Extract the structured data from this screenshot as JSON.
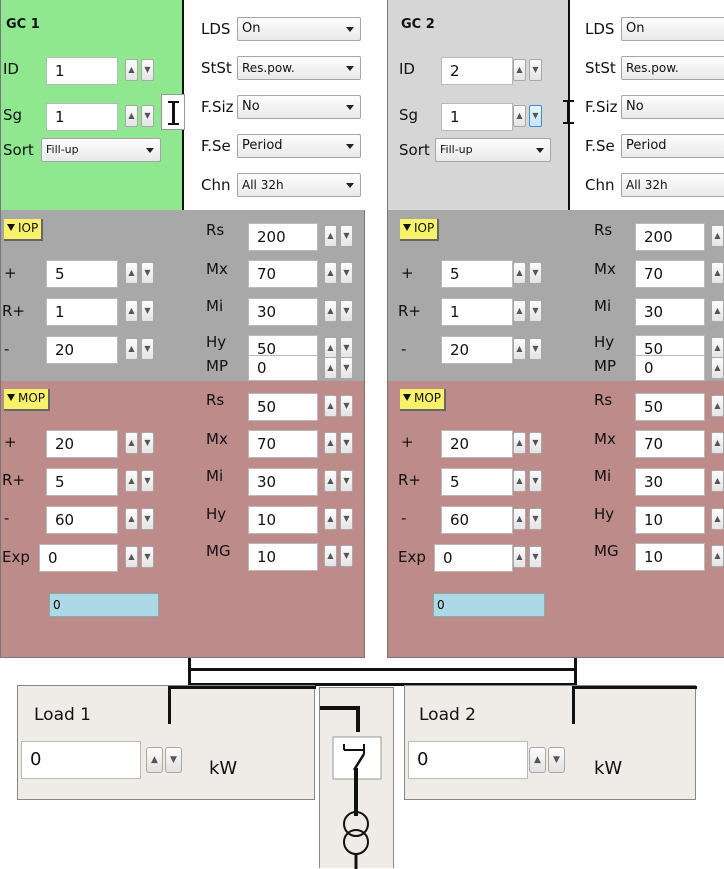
{
  "colors": {
    "gc1_top": "#8fe88f",
    "gc2_top": "#d6d6d6",
    "iop_bg": "#a8a8a8",
    "mop_bg": "#bd8b89",
    "load_bg": "#efebe6",
    "extra_field": "#add8e6"
  },
  "gc1": {
    "title": "GC 1",
    "id_label": "ID",
    "id_value": "1",
    "sg_label": "Sg",
    "sg_value": "1",
    "sort_label": "Sort",
    "sort_value": "Fill-up",
    "lds_label": "LDS",
    "lds_value": "On",
    "stst_label": "StSt",
    "stst_value": "Res.pow.",
    "fsiz_label": "F.Siz",
    "fsiz_value": "No",
    "fsel_label": "F.Se",
    "fsel_value": "Period",
    "chn_label": "Chn",
    "chn_value": "All 32h",
    "iop": {
      "header": "IOP",
      "plus_label": "+",
      "plus_value": "5",
      "rplus_label": "R+",
      "rplus_value": "1",
      "minus_label": "-",
      "minus_value": "20",
      "rs_label": "Rs",
      "rs_value": "200",
      "mx_label": "Mx",
      "mx_value": "70",
      "mi_label": "Mi",
      "mi_value": "30",
      "hy_label": "Hy",
      "hy_value": "50",
      "mp_label": "MP",
      "mp_value": "0"
    },
    "mop": {
      "header": "MOP",
      "plus_label": "+",
      "plus_value": "20",
      "rplus_label": "R+",
      "rplus_value": "5",
      "minus_label": "-",
      "minus_value": "60",
      "exp_label": "Exp",
      "exp_value": "0",
      "rs_label": "Rs",
      "rs_value": "50",
      "mx_label": "Mx",
      "mx_value": "70",
      "mi_label": "Mi",
      "mi_value": "30",
      "hy_label": "Hy",
      "hy_value": "10",
      "mg_label": "MG",
      "mg_value": "10",
      "extra_value": "0"
    }
  },
  "gc2": {
    "title": "GC 2",
    "id_label": "ID",
    "id_value": "2",
    "sg_label": "Sg",
    "sg_value": "1",
    "sort_label": "Sort",
    "sort_value": "Fill-up",
    "lds_label": "LDS",
    "lds_value": "On",
    "stst_label": "StSt",
    "stst_value": "Res.pow.",
    "fsiz_label": "F.Siz",
    "fsiz_value": "No",
    "fsel_label": "F.Se",
    "fsel_value": "Period",
    "chn_label": "Chn",
    "chn_value": "All 32h",
    "iop": {
      "header": "IOP",
      "plus_label": "+",
      "plus_value": "5",
      "rplus_label": "R+",
      "rplus_value": "1",
      "minus_label": "-",
      "minus_value": "20",
      "rs_label": "Rs",
      "rs_value": "200",
      "mx_label": "Mx",
      "mx_value": "70",
      "mi_label": "Mi",
      "mi_value": "30",
      "hy_label": "Hy",
      "hy_value": "50",
      "mp_label": "MP",
      "mp_value": "0"
    },
    "mop": {
      "header": "MOP",
      "plus_label": "+",
      "plus_value": "20",
      "rplus_label": "R+",
      "rplus_value": "5",
      "minus_label": "-",
      "minus_value": "60",
      "exp_label": "Exp",
      "exp_value": "0",
      "rs_label": "Rs",
      "rs_value": "50",
      "mx_label": "Mx",
      "mx_value": "70",
      "mi_label": "Mi",
      "mi_value": "30",
      "hy_label": "Hy",
      "hy_value": "10",
      "mg_label": "MG",
      "mg_value": "10",
      "extra_value": "0"
    }
  },
  "load1": {
    "title": "Load 1",
    "value": "0",
    "unit": "kW"
  },
  "load2": {
    "title": "Load 2",
    "value": "0",
    "unit": "kW"
  },
  "icons": {
    "spin_up": "▲",
    "spin_down": "▼",
    "switch": "breaker-switch-icon",
    "transformer": "transformer-icon",
    "connector": "link-connector-icon"
  }
}
